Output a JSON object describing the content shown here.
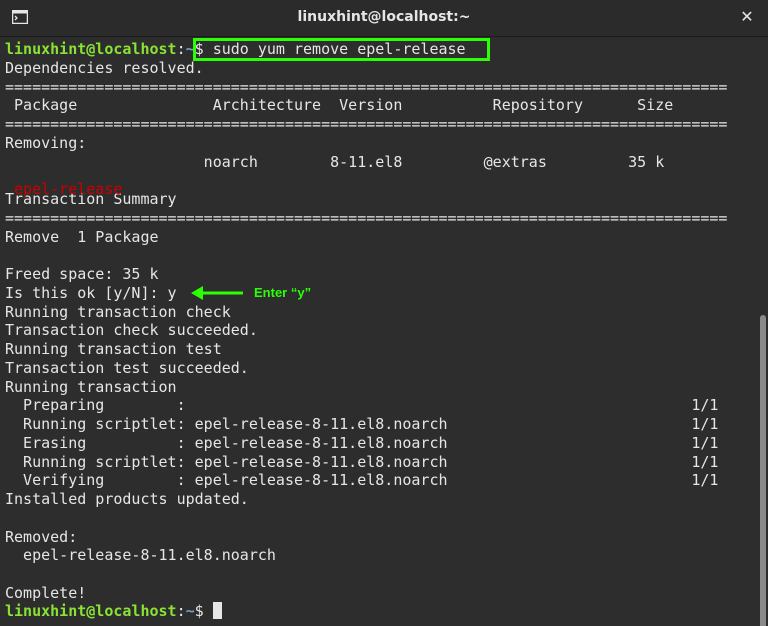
{
  "window": {
    "title": "linuxhint@localhost:~",
    "close_glyph": "✕"
  },
  "prompt": {
    "userhost": "linuxhint@localhost",
    "sep": ":",
    "dir": "~",
    "symbol": "$"
  },
  "command": " sudo yum remove epel-release",
  "lines": [
    "Dependencies resolved.",
    "================================================================================",
    " Package               Architecture  Version          Repository      Size",
    "================================================================================",
    "Removing:",
    "                      noarch        8-11.el8         @extras         35 k",
    "",
    "Transaction Summary",
    "================================================================================",
    "Remove  1 Package",
    "",
    "Freed space: 35 k",
    "Is this ok [y/N]: y",
    "Running transaction check",
    "Transaction check succeeded.",
    "Running transaction test",
    "Transaction test succeeded.",
    "Running transaction",
    "  Preparing        :                                                        1/1",
    "  Running scriptlet: epel-release-8-11.el8.noarch                           1/1",
    "  Erasing          : epel-release-8-11.el8.noarch                           1/1",
    "  Running scriptlet: epel-release-8-11.el8.noarch                           1/1",
    "  Verifying        : epel-release-8-11.el8.noarch                           1/1",
    "Installed products updated.",
    "",
    "Removed:",
    "  epel-release-8-11.el8.noarch",
    "",
    "Complete!"
  ],
  "package_name": " epel-release",
  "annotation": "Enter “y”",
  "colors": {
    "accent": "#2cff05",
    "prompt": "#8ae234",
    "path": "#729fcf",
    "error": "#cc0000"
  },
  "icons": {
    "app": "terminal-icon",
    "close": "close-icon"
  }
}
